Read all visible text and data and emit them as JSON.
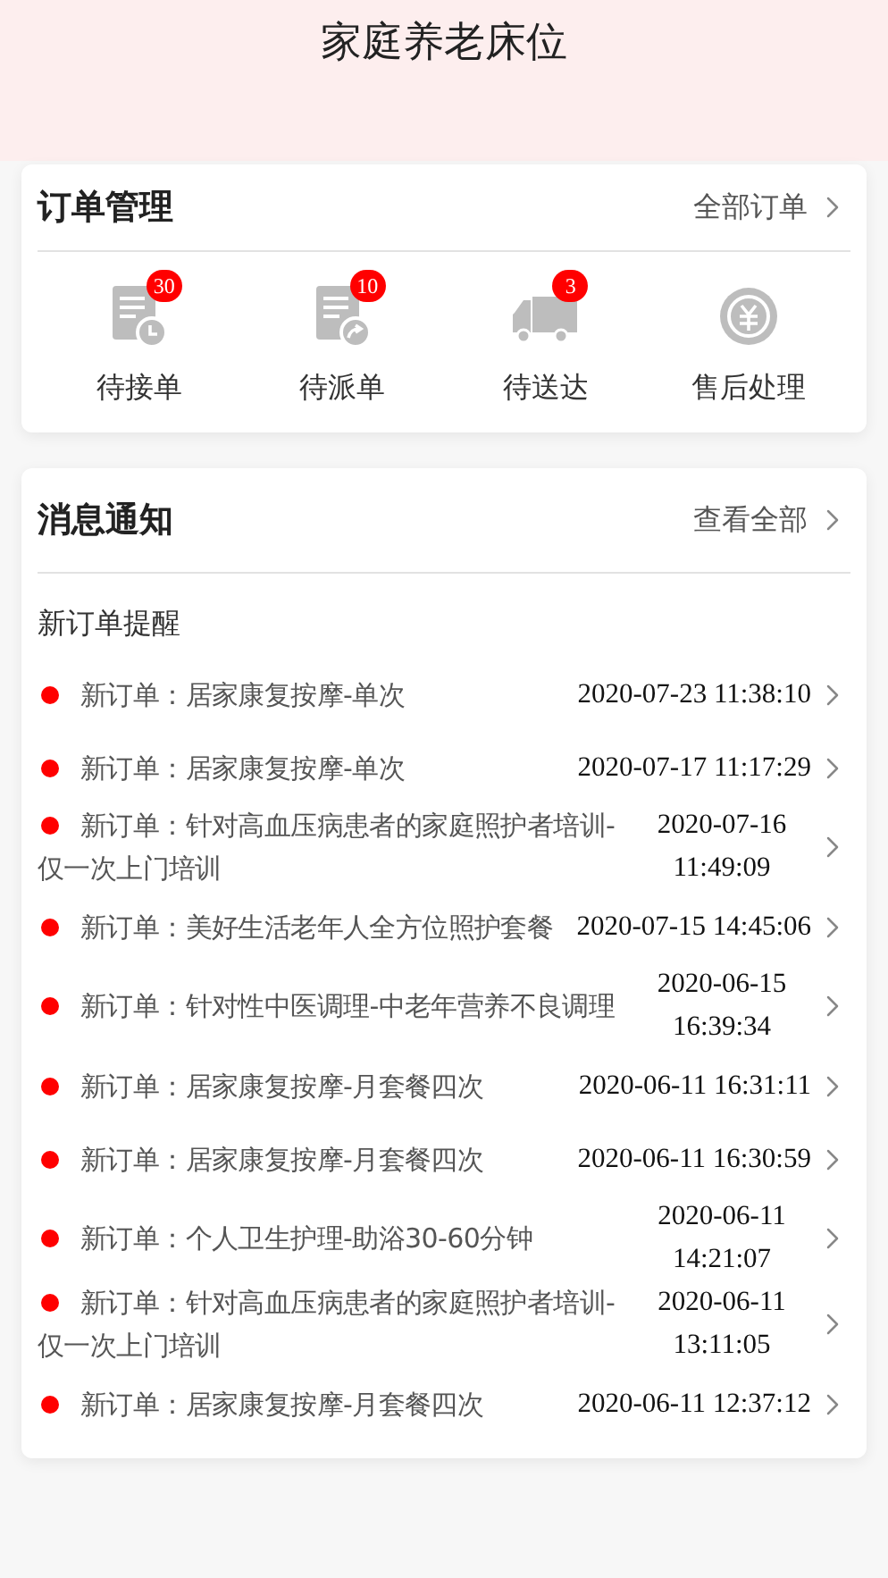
{
  "header": {
    "title": "家庭养老床位"
  },
  "orders": {
    "title": "订单管理",
    "link": "全部订单",
    "items": [
      {
        "kind": "accept",
        "label": "待接单",
        "badge": "30"
      },
      {
        "kind": "dispatch",
        "label": "待派单",
        "badge": "10"
      },
      {
        "kind": "deliver",
        "label": "待送达",
        "badge": "3"
      },
      {
        "kind": "aftersale",
        "label": "售后处理"
      }
    ]
  },
  "notices": {
    "title": "消息通知",
    "link": "查看全部",
    "subtitle": "新订单提醒",
    "items": [
      {
        "text": "新订单：居家康复按摩-单次",
        "time": "2020-07-23 11:38:10"
      },
      {
        "text": "新订单：居家康复按摩-单次",
        "time": "2020-07-17 11:17:29"
      },
      {
        "text": "新订单：针对高血压病患者的家庭照护者培训-仅一次上门培训",
        "time": "2020-07-16 11:49:09"
      },
      {
        "text": "新订单：美好生活老年人全方位照护套餐",
        "time": "2020-07-15 14:45:06"
      },
      {
        "text": "新订单：针对性中医调理-中老年营养不良调理",
        "time": "2020-06-15 16:39:34"
      },
      {
        "text": "新订单：居家康复按摩-月套餐四次",
        "time": "2020-06-11 16:31:11"
      },
      {
        "text": "新订单：居家康复按摩-月套餐四次",
        "time": "2020-06-11 16:30:59"
      },
      {
        "text": "新订单：个人卫生护理-助浴30-60分钟",
        "time": "2020-06-11 14:21:07"
      },
      {
        "text": "新订单：针对高血压病患者的家庭照护者培训-仅一次上门培训",
        "time": "2020-06-11 13:11:05"
      },
      {
        "text": "新订单：居家康复按摩-月套餐四次",
        "time": "2020-06-11 12:37:12"
      }
    ]
  }
}
